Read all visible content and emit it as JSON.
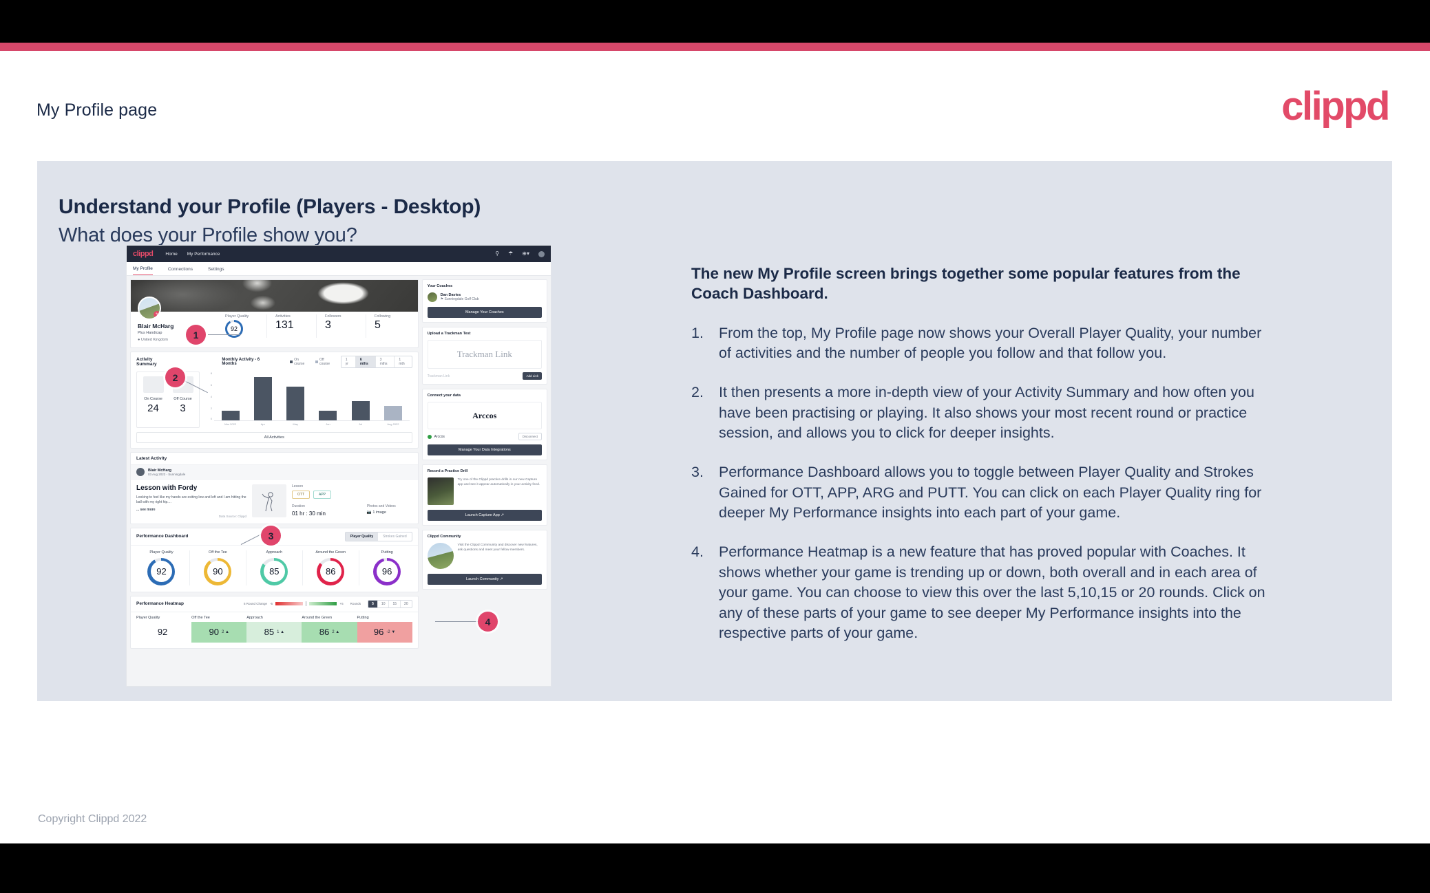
{
  "header": {
    "title": "My Profile page",
    "logo": "clippd"
  },
  "slide": {
    "heading": "Understand your Profile (Players - Desktop)",
    "subheading": "What does your Profile show you?",
    "footer": "Copyright Clippd 2022"
  },
  "explainer": {
    "lead": "The new My Profile screen brings together some popular features from the Coach Dashboard.",
    "items": [
      {
        "num": "1.",
        "text": "From the top, My Profile page now shows your Overall Player Quality, your number of activities and the number of people you follow and that follow you."
      },
      {
        "num": "2.",
        "text": "It then presents a more in-depth view of your Activity Summary and how often you have been practising or playing. It also shows your most recent round or practice session, and allows you to click for deeper insights."
      },
      {
        "num": "3.",
        "text": "Performance Dashboard allows you to toggle between Player Quality and Strokes Gained for OTT, APP, ARG and PUTT. You can click on each Player Quality ring for deeper My Performance insights into each part of your game."
      },
      {
        "num": "4.",
        "text": "Performance Heatmap is a new feature that has proved popular with Coaches. It shows whether your game is trending up or down, both overall and in each area of your game. You can choose to view this over the last 5,10,15 or 20 rounds. Click on any of these parts of your game to see deeper My Performance insights into the respective parts of your game."
      }
    ]
  },
  "callouts": [
    {
      "label": "1"
    },
    {
      "label": "2"
    },
    {
      "label": "3"
    },
    {
      "label": "4"
    }
  ],
  "app": {
    "nav": {
      "logo": "clippd",
      "links": [
        "Home",
        "My Performance"
      ],
      "icons": [
        "search-icon",
        "community-icon",
        "add-icon",
        "avatar-icon"
      ]
    },
    "tabs": [
      {
        "label": "My Profile",
        "active": true
      },
      {
        "label": "Connections",
        "active": false
      },
      {
        "label": "Settings",
        "active": false
      }
    ],
    "profile": {
      "name": "Blair McHarg",
      "handicap": "Plus Handicap",
      "location": "United Kingdom",
      "stats": [
        {
          "label": "Player Quality",
          "value": "92"
        },
        {
          "label": "Activities",
          "value": "131"
        },
        {
          "label": "Followers",
          "value": "3"
        },
        {
          "label": "Following",
          "value": "5"
        }
      ]
    },
    "activity_summary": {
      "title": "Activity Summary",
      "chart_title": "Monthly Activity - 6 Months",
      "legend": [
        "On course",
        "Off course"
      ],
      "ranges": [
        {
          "label": "1 yr",
          "active": false
        },
        {
          "label": "6 mths",
          "active": true
        },
        {
          "label": "3 mths",
          "active": false
        },
        {
          "label": "1 mth",
          "active": false
        }
      ],
      "counters": [
        {
          "label": "On Course",
          "value": "24",
          "icon": "flag-icon"
        },
        {
          "label": "Off Course",
          "value": "3",
          "icon": "monitor-icon"
        }
      ],
      "all_activities": "All Activities"
    },
    "latest_activity": {
      "title": "Latest Activity",
      "user": "Blair McHarg",
      "meta": "03 Aug 2022 - Sunningdale",
      "entry_title": "Lesson with Fordy",
      "entry_desc": "Looking to feel like my hands are exiting low and left and I am hitting the ball with my right hip....",
      "see_more": "... see more",
      "source": "Data Source: Clippd",
      "type_label": "Lesson",
      "tags": [
        "OTT",
        "APP"
      ],
      "duration_label": "Duration",
      "duration": "01 hr : 30 min",
      "media_label": "Photos and Videos",
      "media": "1 image"
    },
    "performance_dashboard": {
      "title": "Performance Dashboard",
      "toggle": [
        {
          "label": "Player Quality",
          "active": true
        },
        {
          "label": "Strokes Gained",
          "active": false
        }
      ],
      "rings": [
        {
          "label": "Player Quality",
          "value": "92",
          "color": "#2c6cb5"
        },
        {
          "label": "Off the Tee",
          "value": "90",
          "color": "#edb836"
        },
        {
          "label": "Approach",
          "value": "85",
          "color": "#4fc9a6"
        },
        {
          "label": "Around the Green",
          "value": "86",
          "color": "#e0234a"
        },
        {
          "label": "Putting",
          "value": "96",
          "color": "#8b2fc9"
        }
      ]
    },
    "performance_heatmap": {
      "title": "Performance Heatmap",
      "legend_label": "5 Round Change",
      "legend_min": "-5",
      "legend_max": "+5",
      "rounds_label": "Rounds",
      "rounds": [
        {
          "label": "5",
          "active": true
        },
        {
          "label": "10",
          "active": false
        },
        {
          "label": "15",
          "active": false
        },
        {
          "label": "20",
          "active": false
        }
      ],
      "cells": [
        {
          "label": "Player Quality",
          "value": "92",
          "delta": "",
          "bg": "#ffffff"
        },
        {
          "label": "Off the Tee",
          "value": "90",
          "delta": "2 ▲",
          "bg": "#a7ddb1"
        },
        {
          "label": "Approach",
          "value": "85",
          "delta": "1 ▲",
          "bg": "#d7eedc"
        },
        {
          "label": "Around the Green",
          "value": "86",
          "delta": "2 ▲",
          "bg": "#a7ddb1"
        },
        {
          "label": "Putting",
          "value": "96",
          "delta": "-2 ▼",
          "bg": "#f0a0a0"
        }
      ]
    },
    "side_cards": {
      "coaches": {
        "title": "Your Coaches",
        "coach_name": "Dan Davies",
        "coach_club": "Sunningdale Golf Club",
        "button": "Manage Your Coaches"
      },
      "trackman": {
        "title": "Upload a Trackman Test",
        "box_text": "Trackman Link",
        "placeholder": "Trackman Link",
        "button": "Add Link"
      },
      "data": {
        "title": "Connect your data",
        "box_text": "Arccos",
        "provider": "Arccos",
        "disconnect": "Disconnect",
        "button": "Manage Your Data Integrations"
      },
      "practice": {
        "title": "Record a Practice Drill",
        "text": "Try one of the Clippd practice drills in our new Capture app and see it appear automatically in your activity feed.",
        "button": "Launch Capture App"
      },
      "community": {
        "title": "Clippd Community",
        "text": "Visit the Clippd Community and discover new features, ask questions and meet your fellow members.",
        "button": "Launch Community"
      }
    }
  },
  "chart_data": {
    "type": "bar",
    "title": "Monthly Activity - 6 Months",
    "categories": [
      "Mar 2022",
      "Apr",
      "May",
      "Jun",
      "Jul",
      "Aug 2022"
    ],
    "values": [
      2,
      9,
      7,
      2,
      4,
      3
    ],
    "series": [
      {
        "name": "On course",
        "values": [
          2,
          9,
          7,
          2,
          4,
          null
        ],
        "color": "#4b5563"
      },
      {
        "name": "Off course",
        "values": [
          null,
          null,
          null,
          null,
          null,
          3
        ],
        "color": "#aab4c4"
      }
    ],
    "xlabel": "",
    "ylabel": "",
    "ylim": [
      0,
      10
    ],
    "yticks": [
      0,
      2,
      4,
      6,
      8
    ],
    "grid": false,
    "legend": "top"
  }
}
